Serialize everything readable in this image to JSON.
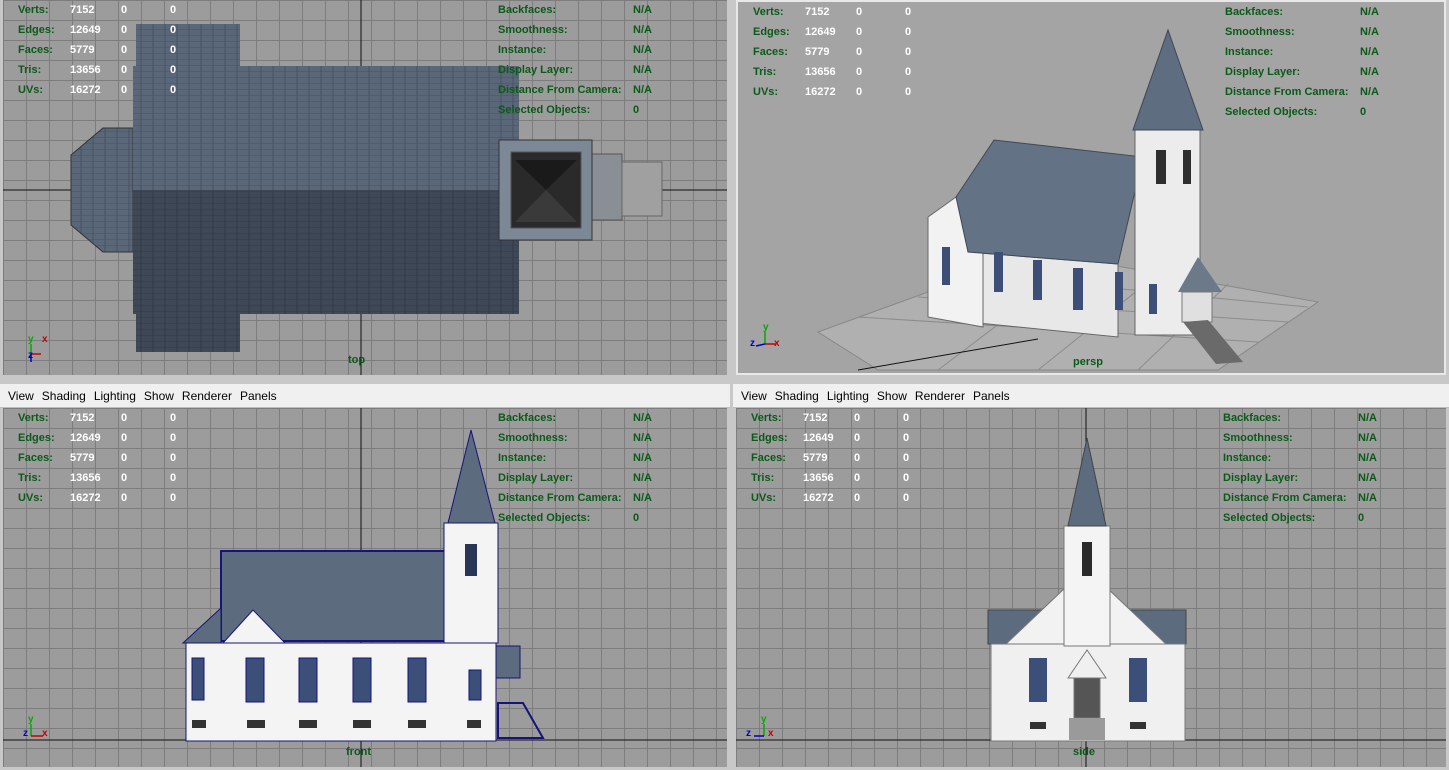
{
  "menu": {
    "view": "View",
    "shading": "Shading",
    "lighting": "Lighting",
    "show": "Show",
    "renderer": "Renderer",
    "panels": "Panels"
  },
  "hud_left": {
    "verts": {
      "label": "Verts:",
      "v1": "7152",
      "v2": "0",
      "v3": "0"
    },
    "edges": {
      "label": "Edges:",
      "v1": "12649",
      "v2": "0",
      "v3": "0"
    },
    "faces": {
      "label": "Faces:",
      "v1": "5779",
      "v2": "0",
      "v3": "0"
    },
    "tris": {
      "label": "Tris:",
      "v1": "13656",
      "v2": "0",
      "v3": "0"
    },
    "uvs": {
      "label": "UVs:",
      "v1": "16272",
      "v2": "0",
      "v3": "0"
    }
  },
  "hud_right": {
    "backfaces": {
      "label": "Backfaces:",
      "value": "N/A"
    },
    "smoothness": {
      "label": "Smoothness:",
      "value": "N/A"
    },
    "instance": {
      "label": "Instance:",
      "value": "N/A"
    },
    "display_layer": {
      "label": "Display Layer:",
      "value": "N/A"
    },
    "distance": {
      "label": "Distance From Camera:",
      "value": "N/A"
    },
    "selected": {
      "label": "Selected Objects:",
      "value": "0"
    }
  },
  "viewports": {
    "top": "top",
    "persp": "persp",
    "front": "front",
    "side": "side"
  },
  "axes": {
    "x": "x",
    "y": "y",
    "z": "z"
  },
  "colors": {
    "hud_label": "#0b5a18",
    "roof": "#5b6a7e",
    "wall": "#f0f0f0",
    "grid_bg": "#9c9c9c"
  }
}
